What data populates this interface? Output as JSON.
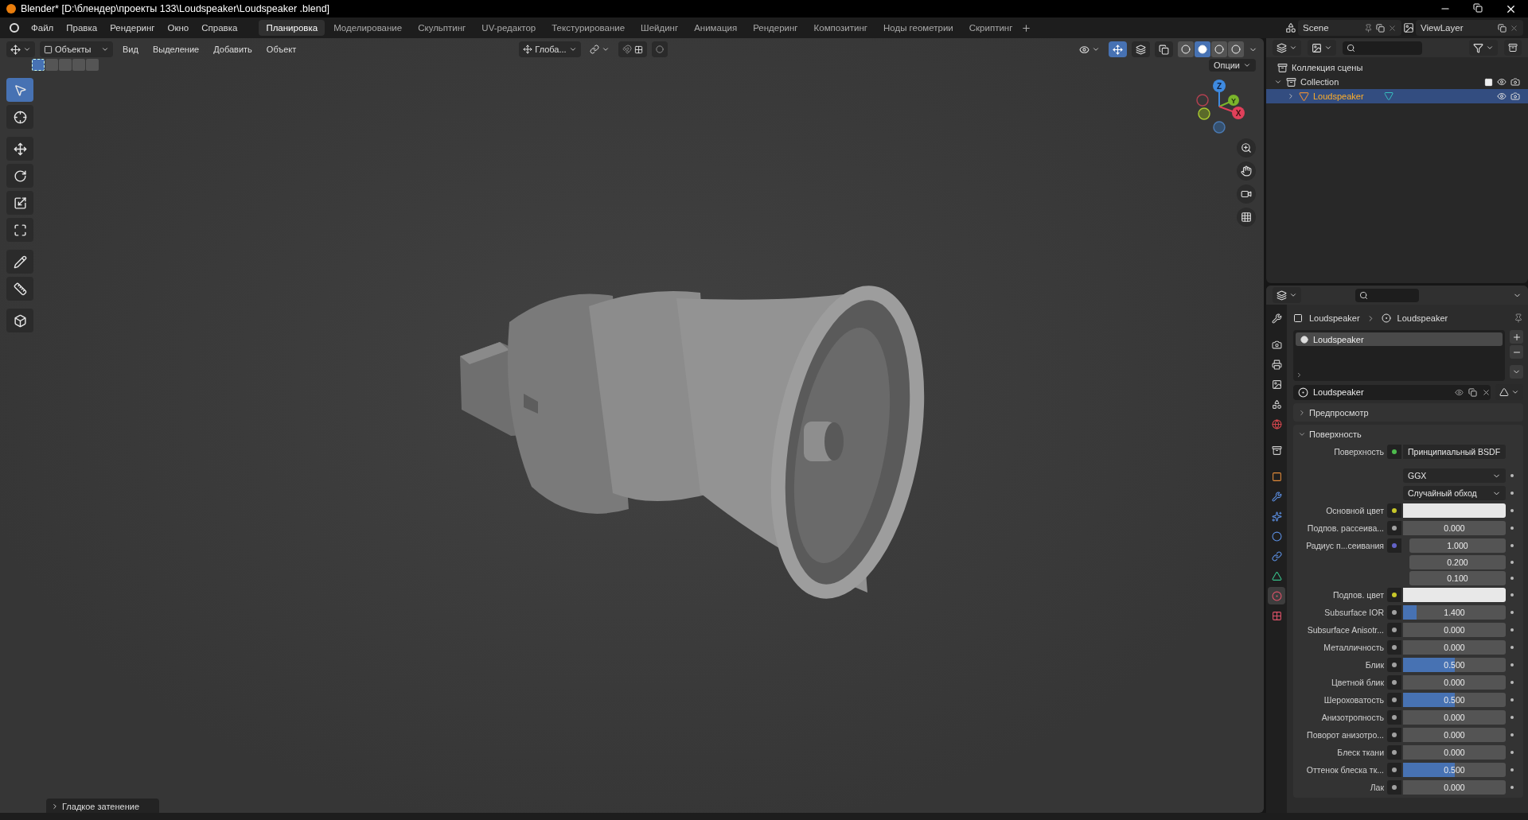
{
  "title": "Blender* [D:\\блендер\\проекты 133\\Loudspeaker\\Loudspeaker .blend]",
  "menu": [
    "Файл",
    "Правка",
    "Рендеринг",
    "Окно",
    "Справка"
  ],
  "workspaces": [
    {
      "label": "Планировка",
      "selected": true
    },
    {
      "label": "Моделирование",
      "selected": false
    },
    {
      "label": "Скульптинг",
      "selected": false
    },
    {
      "label": "UV-редактор",
      "selected": false
    },
    {
      "label": "Текстурирование",
      "selected": false
    },
    {
      "label": "Шейдинг",
      "selected": false
    },
    {
      "label": "Анимация",
      "selected": false
    },
    {
      "label": "Рендеринг",
      "selected": false
    },
    {
      "label": "Композитинг",
      "selected": false
    },
    {
      "label": "Ноды геометрии",
      "selected": false
    },
    {
      "label": "Скриптинг",
      "selected": false
    }
  ],
  "scene": "Scene",
  "view_layer": "ViewLayer",
  "viewport": {
    "mode": "Объекты",
    "menus": [
      "Вид",
      "Выделение",
      "Добавить",
      "Объект"
    ],
    "select_modes": [
      {
        "selected": true
      },
      {
        "selected": false
      },
      {
        "selected": false
      },
      {
        "selected": false
      },
      {
        "selected": false
      }
    ],
    "orientation": "Глоба...",
    "gizmos_on": true,
    "shading": [
      {
        "selected": false
      },
      {
        "selected": true
      },
      {
        "selected": false
      },
      {
        "selected": false
      }
    ],
    "options": "Опции",
    "gizmo_axes": [
      "Z",
      "Y",
      "X"
    ],
    "tools": [
      {
        "kind": "select",
        "selected": true
      },
      {
        "kind": "cursor",
        "selected": false
      },
      {
        "kind": "move",
        "selected": false
      },
      {
        "kind": "rotate",
        "selected": false
      },
      {
        "kind": "scale",
        "selected": false
      },
      {
        "kind": "transform",
        "selected": false
      },
      {
        "kind": "annotate",
        "selected": false
      },
      {
        "kind": "measure",
        "selected": false
      },
      {
        "kind": "add",
        "selected": false
      }
    ],
    "last_operator": {
      "label": "Гладкое затенение",
      "expanded": false
    }
  },
  "outliner": {
    "root": "Коллекция сцены",
    "children": [
      {
        "label": "Collection",
        "expanded": true,
        "children": [
          {
            "label": "Loudspeaker",
            "selected": true,
            "expanded": false
          }
        ]
      }
    ]
  },
  "properties": {
    "tabs": [
      {
        "kind": "tool",
        "selected": false
      },
      {
        "kind": "render",
        "selected": false
      },
      {
        "kind": "output",
        "selected": false
      },
      {
        "kind": "view_layer",
        "selected": false
      },
      {
        "kind": "scene",
        "selected": false
      },
      {
        "kind": "world",
        "selected": false
      },
      {
        "kind": "collection",
        "selected": false
      },
      {
        "kind": "object",
        "selected": false
      },
      {
        "kind": "modifier",
        "selected": false
      },
      {
        "kind": "particles",
        "selected": false
      },
      {
        "kind": "physics",
        "selected": false
      },
      {
        "kind": "constraints",
        "selected": false
      },
      {
        "kind": "data",
        "selected": false
      },
      {
        "kind": "material",
        "selected": true
      },
      {
        "kind": "texture",
        "selected": false
      }
    ],
    "breadcrumb": [
      "Loudspeaker",
      "Loudspeaker"
    ],
    "slots": [
      {
        "label": "Loudspeaker",
        "selected": true
      }
    ],
    "material": "Loudspeaker",
    "panels": [
      {
        "label": "Предпросмотр",
        "expanded": false
      },
      {
        "label": "Поверхность",
        "expanded": true
      }
    ],
    "surface": [
      {
        "kind": "shader",
        "label": "Поверхность",
        "value": "Принципиальный BSDF",
        "color": "#4dbb4d"
      },
      {
        "kind": "dropdown",
        "value": "GGX"
      },
      {
        "kind": "dropdown",
        "value": "Случайный обход"
      },
      {
        "kind": "color",
        "label": "Основной цвет",
        "color": "#c7c729"
      },
      {
        "kind": "number",
        "label": "Подпов. рассеива...",
        "value": "0.000",
        "level": 0,
        "color": "#a1a1a1"
      },
      {
        "kind": "vector",
        "label": "Радиус п...сеивания",
        "values": [
          "1.000",
          "0.200",
          "0.100"
        ],
        "color": "#6363c7"
      },
      {
        "kind": "color",
        "label": "Подпов. цвет",
        "color": "#c7c729"
      },
      {
        "kind": "number",
        "label": "Subsurface IOR",
        "value": "1.400",
        "level": 0.13,
        "color": "#a1a1a1"
      },
      {
        "kind": "number",
        "label": "Subsurface Anisotr...",
        "value": "0.000",
        "level": 0,
        "color": "#a1a1a1"
      },
      {
        "kind": "number",
        "label": "Металличность",
        "value": "0.000",
        "level": 0,
        "color": "#a1a1a1"
      },
      {
        "kind": "number",
        "label": "Блик",
        "value": "0.500",
        "level": 0.5,
        "color": "#a1a1a1"
      },
      {
        "kind": "number",
        "label": "Цветной блик",
        "value": "0.000",
        "level": 0,
        "color": "#a1a1a1"
      },
      {
        "kind": "number",
        "label": "Шероховатость",
        "value": "0.500",
        "level": 0.5,
        "color": "#a1a1a1"
      },
      {
        "kind": "number",
        "label": "Анизотропность",
        "value": "0.000",
        "level": 0,
        "color": "#a1a1a1"
      },
      {
        "kind": "number",
        "label": "Поворот анизотро...",
        "value": "0.000",
        "level": 0,
        "color": "#a1a1a1"
      },
      {
        "kind": "number",
        "label": "Блеск ткани",
        "value": "0.000",
        "level": 0,
        "color": "#a1a1a1"
      },
      {
        "kind": "number",
        "label": "Оттенок блеска тк...",
        "value": "0.500",
        "level": 0.5,
        "color": "#a1a1a1"
      },
      {
        "kind": "number",
        "label": "Лак",
        "value": "0.000",
        "level": 0,
        "color": "#a1a1a1"
      }
    ]
  }
}
